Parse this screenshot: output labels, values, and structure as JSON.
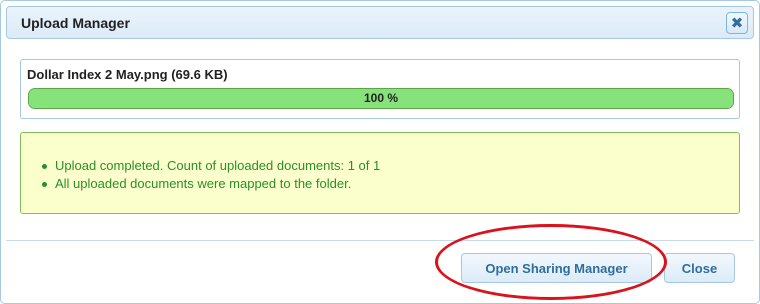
{
  "dialog": {
    "title": "Upload Manager",
    "close_icon": "close-x-icon"
  },
  "upload": {
    "file_label": "Dollar Index 2 May.png (69.6 KB)",
    "progress_percent": 100,
    "progress_text": "100 %",
    "progress_color": "#86e27a"
  },
  "messages": {
    "items": [
      "Upload completed. Count of uploaded documents: 1 of 1",
      "All uploaded documents were mapped to the folder."
    ],
    "text_color": "#2a8f2a",
    "background": "#fbffcc"
  },
  "buttons": {
    "open_sharing_manager": "Open Sharing Manager",
    "close": "Close"
  },
  "annotation": {
    "shape": "ellipse",
    "color": "#d9121b",
    "target": "Open Sharing Manager"
  }
}
